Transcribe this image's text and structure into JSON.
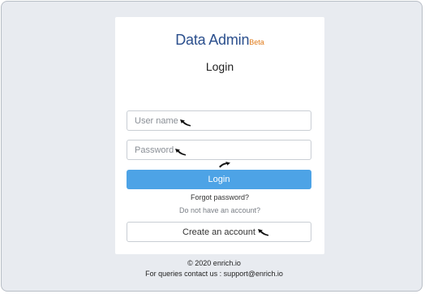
{
  "brand": {
    "name": "Data Admin",
    "tag": "Beta"
  },
  "login": {
    "title": "Login",
    "username_placeholder": "User name",
    "password_placeholder": "Password",
    "login_label": "Login",
    "forgot_label": "Forgot password?",
    "no_account_text": "Do not have an account?",
    "create_label": "Create an account"
  },
  "footer": {
    "copyright": "© 2020 enrich.io",
    "contact": "For queries contact us : support@enrich.io"
  },
  "icons": [
    "cursor-arrow-icon"
  ],
  "colors": {
    "background": "#e8ebf0",
    "brand": "#2b4f8d",
    "beta": "#e07b1a",
    "primary_button": "#4da3e6"
  }
}
